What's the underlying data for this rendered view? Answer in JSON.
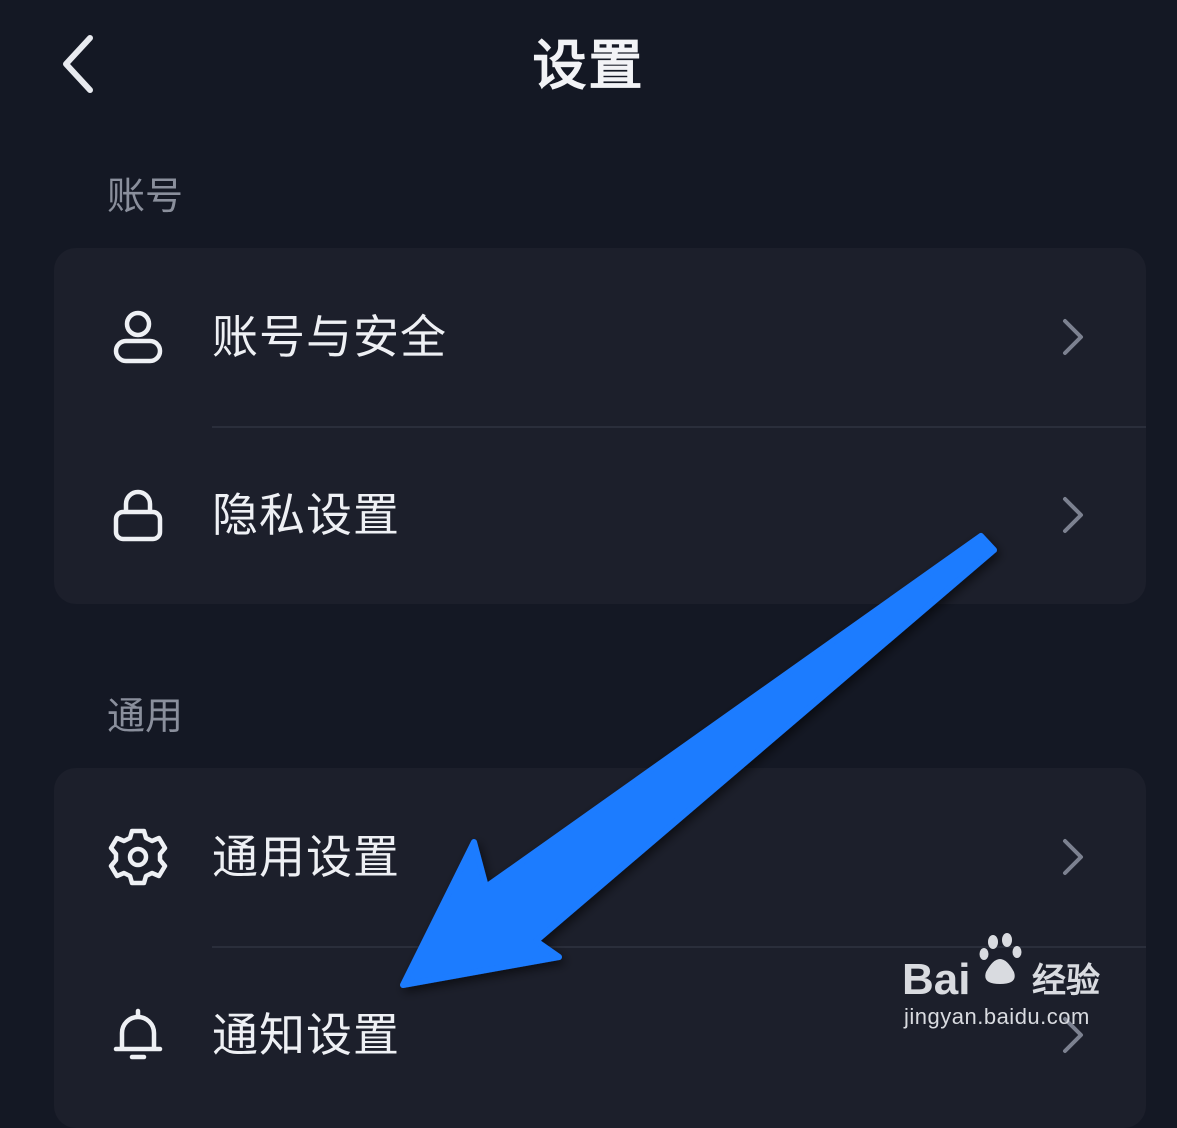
{
  "header": {
    "title": "设置",
    "back_icon": "chevron-left-icon"
  },
  "sections": [
    {
      "label": "账号",
      "items": [
        {
          "label": "账号与安全",
          "icon": "user-icon"
        },
        {
          "label": "隐私设置",
          "icon": "lock-icon"
        }
      ]
    },
    {
      "label": "通用",
      "items": [
        {
          "label": "通用设置",
          "icon": "gear-icon"
        },
        {
          "label": "通知设置",
          "icon": "bell-icon"
        }
      ]
    }
  ],
  "annotation": {
    "arrow_color": "#1e7bff",
    "arrow_target": "通知设置"
  },
  "watermark": {
    "brand": "Bai经验",
    "domain": "jingyan.baidu.com"
  },
  "colors": {
    "background": "#141824",
    "card": "#1c1f2b",
    "text": "#eef0f4",
    "section_label": "#8a8f9c"
  }
}
